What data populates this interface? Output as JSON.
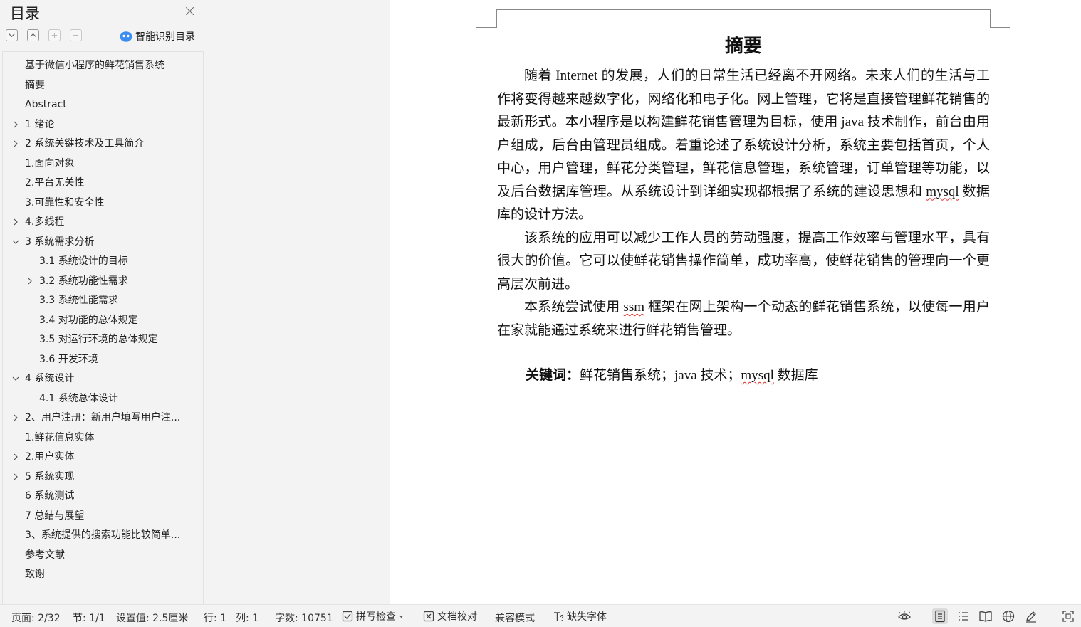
{
  "sidebar": {
    "title": "目录",
    "smart_toc_label": "智能识别目录",
    "items": [
      {
        "label": "基于微信小程序的鲜花销售系统",
        "level": 1,
        "toggle": "none"
      },
      {
        "label": "摘要",
        "level": 1,
        "toggle": "none"
      },
      {
        "label": "Abstract",
        "level": 1,
        "toggle": "none"
      },
      {
        "label": "1  绪论",
        "level": 1,
        "toggle": "collapsed"
      },
      {
        "label": "2 系统关键技术及工具简介",
        "level": 1,
        "toggle": "collapsed"
      },
      {
        "label": "1.面向对象",
        "level": 1,
        "toggle": "none"
      },
      {
        "label": "2.平台无关性",
        "level": 1,
        "toggle": "none"
      },
      {
        "label": "3.可靠性和安全性",
        "level": 1,
        "toggle": "none"
      },
      {
        "label": "4.多线程",
        "level": 1,
        "toggle": "collapsed"
      },
      {
        "label": "3 系统需求分析",
        "level": 1,
        "toggle": "expanded"
      },
      {
        "label": "3.1 系统设计的目标",
        "level": 2,
        "toggle": "none"
      },
      {
        "label": "3.2 系统功能性需求",
        "level": 2,
        "toggle": "collapsed"
      },
      {
        "label": "3.3 系统性能需求",
        "level": 2,
        "toggle": "none"
      },
      {
        "label": "3.4 对功能的总体规定",
        "level": 2,
        "toggle": "none"
      },
      {
        "label": "3.5 对运行环境的总体规定",
        "level": 2,
        "toggle": "none"
      },
      {
        "label": "3.6 开发环境",
        "level": 2,
        "toggle": "none"
      },
      {
        "label": "4 系统设计",
        "level": 1,
        "toggle": "expanded"
      },
      {
        "label": "4.1 系统总体设计",
        "level": 2,
        "toggle": "none"
      },
      {
        "label": "2、用户注册：新用户填写用户注...",
        "level": 1,
        "toggle": "collapsed"
      },
      {
        "label": "1.鲜花信息实体",
        "level": 1,
        "toggle": "none"
      },
      {
        "label": "2.用户实体",
        "level": 1,
        "toggle": "collapsed"
      },
      {
        "label": "5 系统实现",
        "level": 1,
        "toggle": "collapsed"
      },
      {
        "label": "6 系统测试",
        "level": 1,
        "toggle": "none"
      },
      {
        "label": "7 总结与展望",
        "level": 1,
        "toggle": "none"
      },
      {
        "label": "3、系统提供的搜索功能比较简单...",
        "level": 1,
        "toggle": "none"
      },
      {
        "label": "参考文献",
        "level": 1,
        "toggle": "none"
      },
      {
        "label": "致谢",
        "level": 1,
        "toggle": "none"
      }
    ]
  },
  "document": {
    "heading": "摘要",
    "p1_a": "随着 Internet 的发展，人们的日常生活已经离不开网络。未来人们的生活与工作将变得越来越数字化，网络化和电子化。网上管理，它将是直接管理鲜花销售的最新形式。本小程序是以构建鲜花销售管理为目标，使用 java 技术制作，前台由用户组成，后台由管理员组成。着重论述了系统设计分析，系统主要包括首页，个人中心，用户管理，鲜花分类管理，鲜花信息管理，系统管理，订单管理等功能，以及后台数据库管理。从系统设计到详细实现都根据了系统的建设思想和 ",
    "p1_mysql": "mysql",
    "p1_b": " 数据库的设计方法。",
    "p2": "该系统的应用可以减少工作人员的劳动强度，提高工作效率与管理水平，具有很大的价值。它可以使鲜花销售操作简单，成功率高，使鲜花销售的管理向一个更高层次前进。",
    "p3_a": "本系统尝试使用 ",
    "p3_ssm": "ssm",
    "p3_b": " 框架在网上架构一个动态的鲜花销售系统，以使每一用户在家就能通过系统来进行鲜花销售管理。",
    "kw_label": "关键词：",
    "kw_a": "鲜花销售系统；java 技术；",
    "kw_mysql": "mysql",
    "kw_b": " 数据库"
  },
  "status": {
    "page": "页面: 2/32",
    "section": "节: 1/1",
    "setting": "设置值: 2.5厘米",
    "row": "行: 1",
    "col": "列: 1",
    "words": "字数: 10751",
    "spell_check": "拼写检查",
    "doc_proof": "文档校对",
    "compat_mode": "兼容模式",
    "missing_fonts": "缺失字体"
  },
  "colors": {
    "accent": "#2f7de1",
    "squiggle": "#e03030"
  }
}
